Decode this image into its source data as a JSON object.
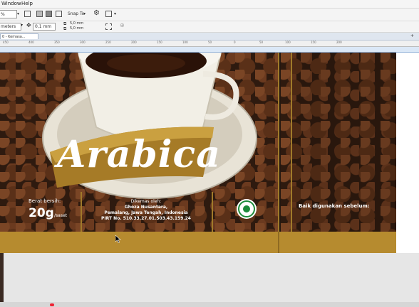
{
  "menu": {
    "items": [
      {
        "label": "Window"
      },
      {
        "label": "Help"
      }
    ]
  },
  "toolbar": {
    "zoom_value": "%",
    "snap_label": "Snap To",
    "units_label": "meters",
    "nudge_value": "0,1 mm",
    "dup_x": "5,0 mm",
    "dup_y": "5,0 mm"
  },
  "document_tab": {
    "label": "0 - Kemasa..."
  },
  "ruler": {
    "ticks": [
      "450",
      "400",
      "350",
      "300",
      "250",
      "200",
      "150",
      "100",
      "50",
      "0",
      "50",
      "100",
      "150",
      "200"
    ]
  },
  "artwork": {
    "brand": "Arabica",
    "weight_label": "Berat bersih:",
    "weight_value": "20g",
    "weight_unit": "/saset",
    "producer_line1": "Dikemas oleh:",
    "producer_line2": "Ghoza Nusantara,",
    "producer_line3": "Pemalang, Jawa Tengah, Indonesia",
    "producer_line4": "PIRT No. 510.33.27.01.503.43.159.24",
    "best_before": "Baik digunakan sebelum:"
  },
  "colors": {
    "gold": "#b68b2f",
    "dark": "#231710",
    "canvas": "#ffffff"
  }
}
